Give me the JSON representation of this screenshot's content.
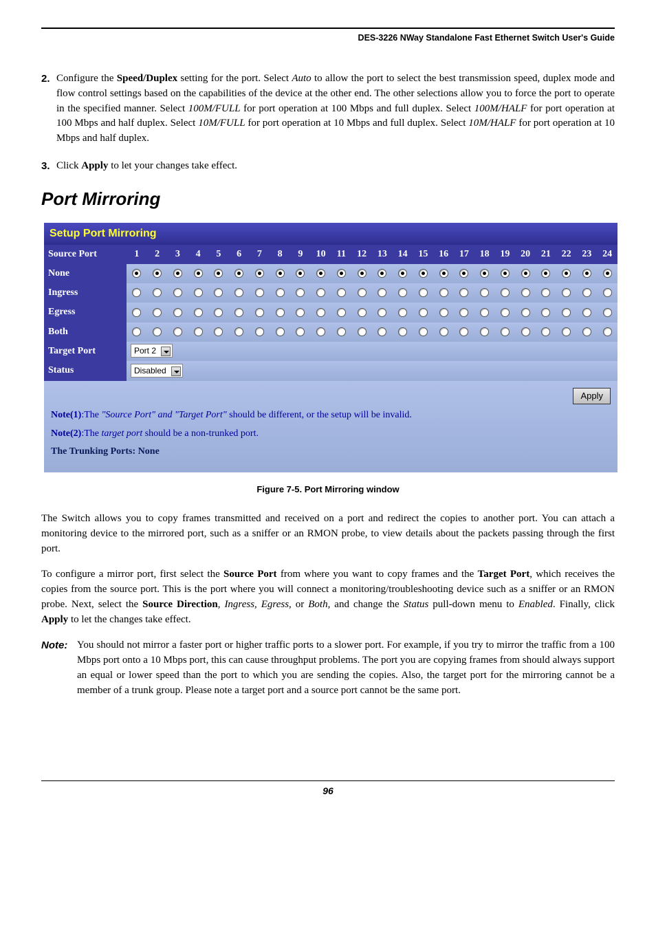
{
  "header": {
    "title": "DES-3226 NWay Standalone Fast Ethernet Switch User's Guide"
  },
  "step2": {
    "num": "2.",
    "pre": "Configure the ",
    "bold1": "Speed/Duplex",
    "mid1": " setting for the port. Select ",
    "it1": "Auto",
    "mid2": " to allow the port to select the best transmission speed, duplex mode and flow control settings based on the capabilities of the device at the other end. The other selections allow you to force the port to operate in the specified manner. Select ",
    "it2": "100M/FULL",
    "mid3": " for port operation at 100 Mbps and full duplex. Select ",
    "it3": "100M/HALF",
    "mid4": " for port operation at 100 Mbps and half duplex. Select ",
    "it4": "10M/FULL",
    "mid5": " for port operation at 10 Mbps and full duplex. Select ",
    "it5": "10M/HALF",
    "mid6": " for port operation at 10 Mbps and half duplex."
  },
  "step3": {
    "num": "3.",
    "pre": "Click ",
    "bold": "Apply",
    "post": " to let your changes take effect."
  },
  "section_title": "Port Mirroring",
  "panel": {
    "title": "Setup Port Mirroring",
    "source_port_label": "Source Port",
    "ports": [
      "1",
      "2",
      "3",
      "4",
      "5",
      "6",
      "7",
      "8",
      "9",
      "10",
      "11",
      "12",
      "13",
      "14",
      "15",
      "16",
      "17",
      "18",
      "19",
      "20",
      "21",
      "22",
      "23",
      "24"
    ],
    "rows": [
      {
        "label": "None",
        "selected_row": true
      },
      {
        "label": "Ingress",
        "selected_row": false
      },
      {
        "label": "Egress",
        "selected_row": false
      },
      {
        "label": "Both",
        "selected_row": false
      }
    ],
    "target_port_label": "Target Port",
    "target_port_value": "Port 2",
    "status_label": "Status",
    "status_value": "Disabled",
    "apply_label": "Apply",
    "note1_b": "Note(1)",
    "note1_a": ":The ",
    "note1_it": "\"Source Port\" and \"Target Port\"",
    "note1_c": " should be different, or the setup will be invalid.",
    "note2_b": "Note(2)",
    "note2_a": ":The ",
    "note2_it": "target port",
    "note2_c": " should be a non-trunked port.",
    "trunking": "The Trunking Ports: None"
  },
  "fig_caption": "Figure 7-5.  Port Mirroring window",
  "para1": "The Switch allows you to copy frames transmitted and received on a port and redirect the copies to another port. You can attach a monitoring device to the mirrored port, such as a sniffer or an RMON probe, to view details about the packets passing through the first port.",
  "para2": {
    "a": "To configure a mirror port, first select the ",
    "b1": "Source Port",
    "b": " from where you want to copy frames and the ",
    "b2": "Target Port",
    "c": ", which receives the copies from the source port. This is the port where you will connect a monitoring/troubleshooting device such as a sniffer or an RMON probe. Next, select the ",
    "b3": "Source Direction",
    "d": ", ",
    "i1": "Ingress",
    "e": ", ",
    "i2": "Egress",
    "f": ", or ",
    "i3": "Both,",
    "g": " and change the ",
    "i4": "Status",
    "h": " pull-down menu to ",
    "i5": "Enabled",
    "i": ". Finally, click ",
    "b4": "Apply",
    "j": " to let the changes take effect."
  },
  "note": {
    "tag": "Note:",
    "body": "You should not mirror a faster port or higher traffic ports to a slower port. For example, if you try to mirror the traffic from a 100 Mbps port onto a 10 Mbps port, this can cause throughput problems. The port you are copying frames from should always support an equal or lower speed than the port to which you are sending the copies. Also, the target port for the mirroring cannot be a member of a trunk group. Please note a target port and a source port cannot be the same port."
  },
  "page_number": "96"
}
